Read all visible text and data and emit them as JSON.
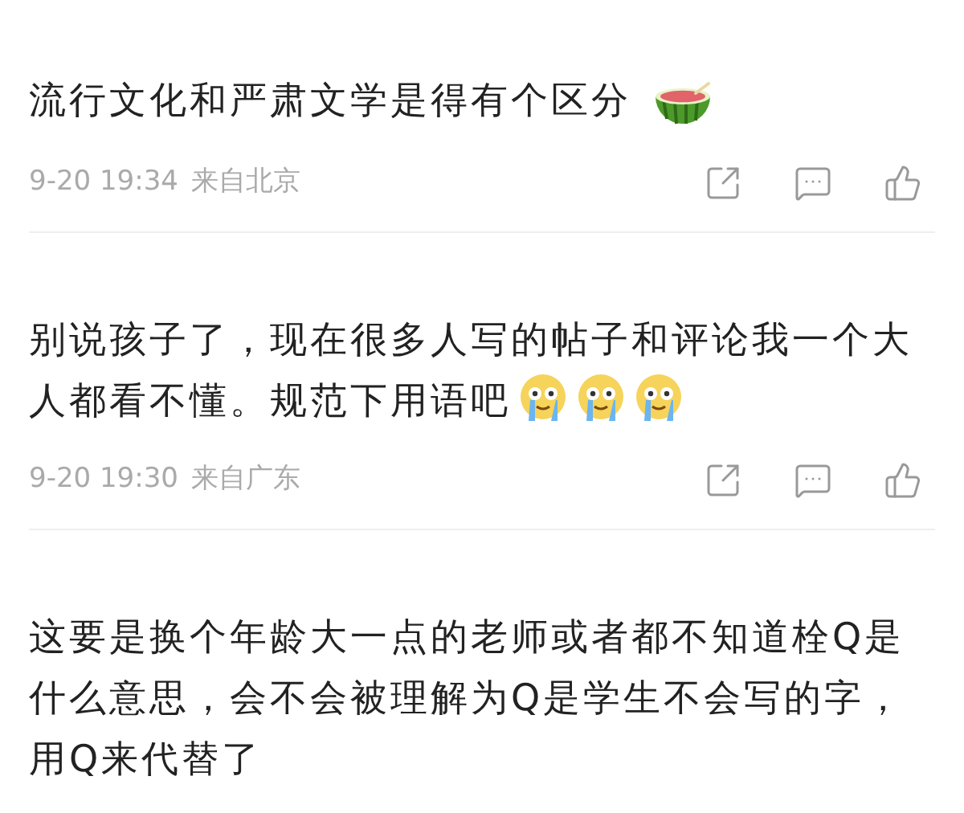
{
  "comments": [
    {
      "text": "流行文化和严肃文学是得有个区分",
      "emojis": [
        {
          "kind": "watermelon"
        }
      ],
      "time": "9-20 19:34",
      "location": "来自北京"
    },
    {
      "text": "别说孩子了，现在很多人写的帖子和评论我一个大人都看不懂。规范下用语吧",
      "emojis": [
        {
          "kind": "crying"
        },
        {
          "kind": "crying"
        },
        {
          "kind": "crying"
        }
      ],
      "time": "9-20 19:30",
      "location": "来自广东"
    },
    {
      "text": "这要是换个年龄大一点的老师或者都不知道栓Q是什么意思，会不会被理解为Q是学生不会写的字，用Q来代替了"
    }
  ]
}
